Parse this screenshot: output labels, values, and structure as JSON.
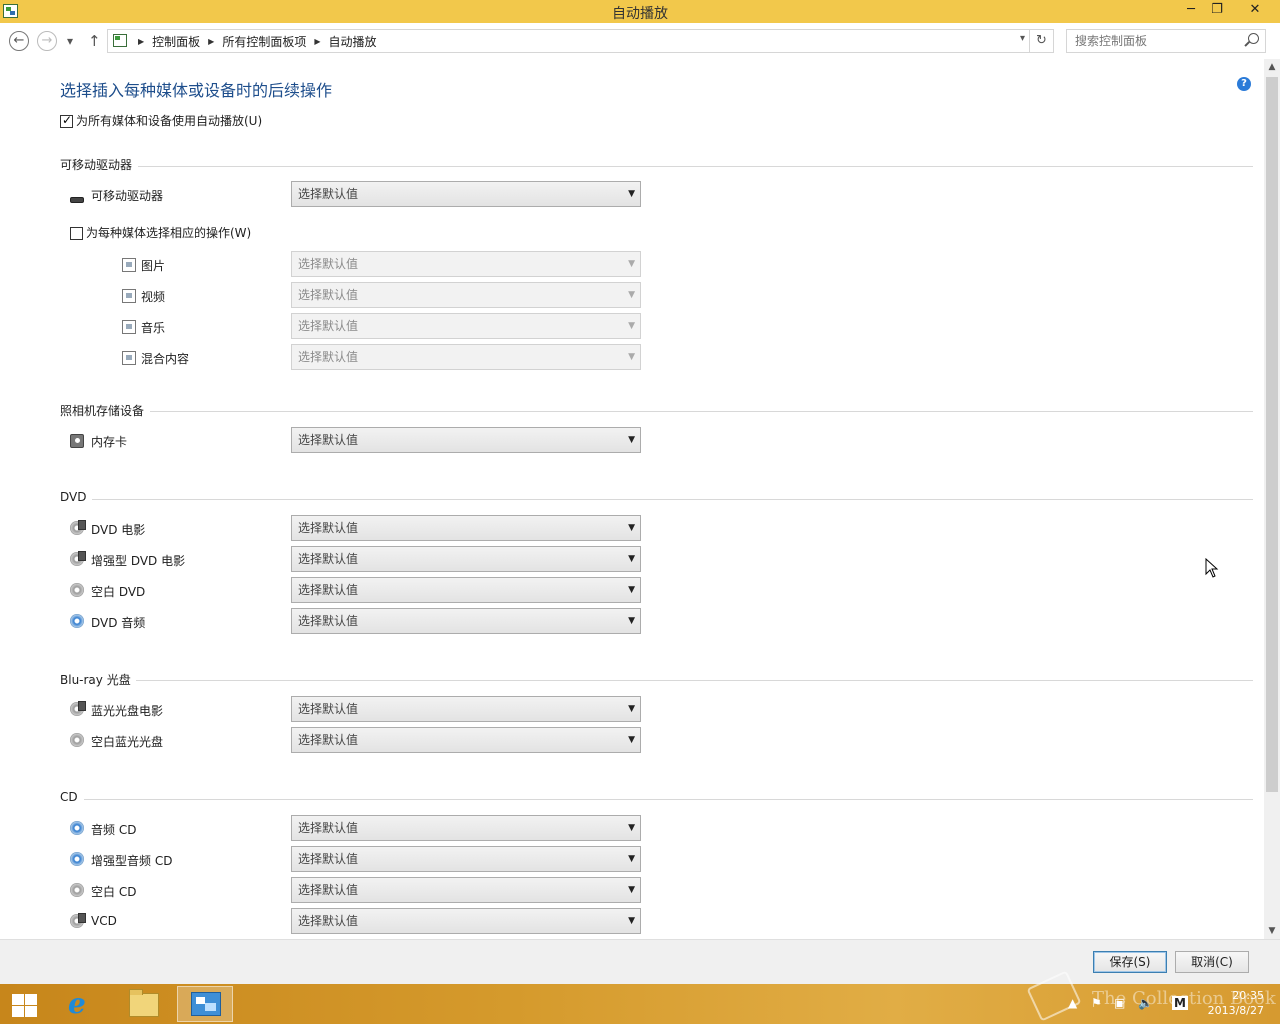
{
  "window": {
    "title": "自动播放",
    "controls": {
      "minimize": "─",
      "maximize": "❐",
      "close": "✕"
    }
  },
  "nav": {
    "back": "←",
    "forward": "→",
    "history": "▾",
    "up": "↑",
    "breadcrumbs": [
      "控制面板",
      "所有控制面板项",
      "自动播放"
    ],
    "dropdown": "▾",
    "refresh": "↻",
    "search_placeholder": "搜索控制面板"
  },
  "main": {
    "heading": "选择插入每种媒体或设备时的后续操作",
    "help": "?",
    "autoplay_all": {
      "label": "为所有媒体和设备使用自动播放(U)",
      "checked": true
    },
    "default_value": "选择默认值",
    "sections": {
      "removable": {
        "title": "可移动驱动器",
        "drive_label": "可移动驱动器",
        "per_media_label": "为每种媒体选择相应的操作(W)",
        "per_media_checked": false,
        "items": [
          {
            "label": "图片",
            "icon": "picture-icon"
          },
          {
            "label": "视频",
            "icon": "video-icon"
          },
          {
            "label": "音乐",
            "icon": "music-icon"
          },
          {
            "label": "混合内容",
            "icon": "mixed-content-icon"
          }
        ]
      },
      "camera": {
        "title": "照相机存储设备",
        "items": [
          {
            "label": "内存卡",
            "icon": "memory-card-icon"
          }
        ]
      },
      "dvd": {
        "title": "DVD",
        "items": [
          {
            "label": "DVD 电影",
            "icon": "dvd-movie-icon"
          },
          {
            "label": "增强型 DVD 电影",
            "icon": "enhanced-dvd-movie-icon"
          },
          {
            "label": "空白 DVD",
            "icon": "blank-dvd-icon"
          },
          {
            "label": "DVD 音频",
            "icon": "dvd-audio-icon"
          }
        ]
      },
      "bluray": {
        "title": "Blu-ray 光盘",
        "items": [
          {
            "label": "蓝光光盘电影",
            "icon": "bluray-movie-icon"
          },
          {
            "label": "空白蓝光光盘",
            "icon": "blank-bluray-icon"
          }
        ]
      },
      "cd": {
        "title": "CD",
        "items": [
          {
            "label": "音频 CD",
            "icon": "audio-cd-icon"
          },
          {
            "label": "增强型音频 CD",
            "icon": "enhanced-audio-cd-icon"
          },
          {
            "label": "空白 CD",
            "icon": "blank-cd-icon"
          },
          {
            "label": "VCD",
            "icon": "vcd-icon"
          }
        ]
      }
    }
  },
  "footer": {
    "save": "保存(S)",
    "cancel": "取消(C)"
  },
  "taskbar": {
    "ie_glyph": "e",
    "tray_flag": "⚑",
    "tray_network": "▣",
    "tray_volume": "🔈",
    "tray_ime": "M",
    "tray_chevron": "▲",
    "time": "20:35",
    "date": "2013/8/27",
    "watermark": "The Collection Book"
  },
  "colors": {
    "titlebar": "#f2c84b",
    "heading": "#1e4e8c",
    "taskbar": "#d59a2c"
  }
}
